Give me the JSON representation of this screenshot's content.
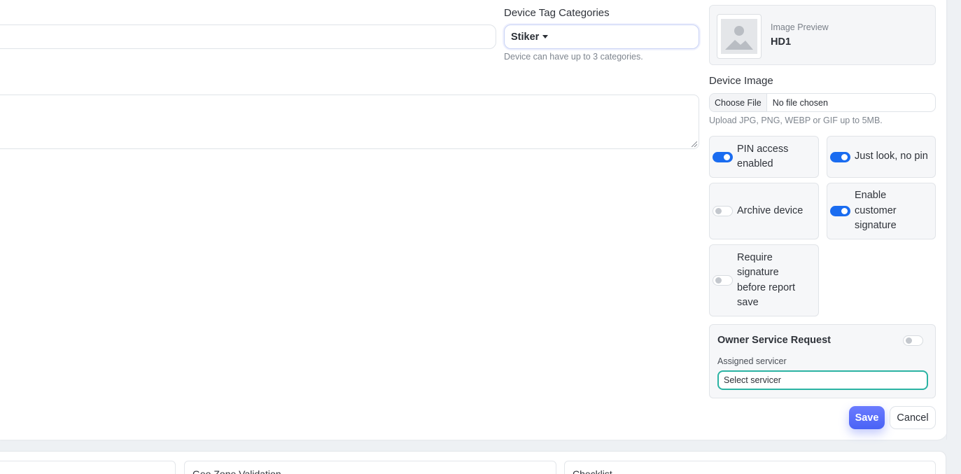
{
  "form": {
    "tag_categories": {
      "label": "Device Tag Categories",
      "selected": "Stiker",
      "hint": "Device can have up to 3 categories."
    },
    "image_preview": {
      "caption": "Image Preview",
      "name": "HD1"
    },
    "device_image": {
      "label": "Device Image",
      "button": "Choose File",
      "status": "No file chosen",
      "hint": "Upload JPG, PNG, WEBP or GIF up to 5MB."
    },
    "toggles": {
      "pin_access": {
        "label": "PIN access enabled",
        "on": true
      },
      "just_look": {
        "label": "Just look, no pin",
        "on": true
      },
      "archive": {
        "label": "Archive device",
        "on": false
      },
      "customer_signature": {
        "label": "Enable customer signature",
        "on": true
      },
      "require_signature": {
        "label": "Require signature before report save",
        "on": false
      }
    },
    "owner_service": {
      "title": "Owner Service Request",
      "on": false,
      "assigned_label": "Assigned servicer",
      "servicer_placeholder": "Select servicer"
    },
    "actions": {
      "save": "Save",
      "cancel": "Cancel"
    }
  },
  "bottom_panels": {
    "geo_zone": "Geo Zone Validation",
    "checklist": "Checklist"
  },
  "colors": {
    "accent": "#4a63f5",
    "toggle_on": "#1a6cf0",
    "focus_ring": "#2bb3a3"
  }
}
